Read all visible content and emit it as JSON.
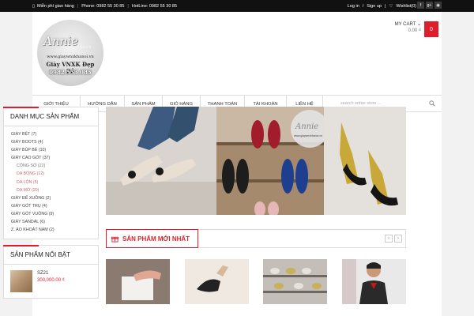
{
  "topbar": {
    "shipping": "Miễn phí giao hàng",
    "phone": "Phone: 0982 55 30 85",
    "hotline": "HotLine: 0982 55 30 85",
    "login": "Log in",
    "signup": "Sign up",
    "wishlist": "Wishlist(0)",
    "social": [
      "f",
      "g+",
      "rss"
    ]
  },
  "logo": {
    "name": "Annie",
    "shop": "SHOP",
    "url": "www.giaywnxkhanoi.vn",
    "tagline": "Giày VNXK Đẹp Rẻ",
    "phone": "0982.553.085"
  },
  "cart": {
    "label": "MY CART",
    "amount": "0.00 ₫",
    "count": "0"
  },
  "nav": {
    "items": [
      "Giới thiệu",
      "Hướng dẫn",
      "Sản phẩm",
      "Giỏ hàng",
      "Thanh toán",
      "Tài khoản",
      "Liên hệ"
    ],
    "search_placeholder": "search entire store ..."
  },
  "categories": {
    "title": "Danh mục sản phẩm",
    "items": [
      "GIÀY BỆT (7)",
      "GIÀY BOOTS (4)",
      "GIÀY BÚP BÊ (10)",
      "GIÀY CAO GÓT (37)",
      "CÔNG SỞ (22)",
      "DA BÓNG (12)",
      "DA LỘN (5)",
      "DA MỜ (20)",
      "GIÀY ĐẾ XUỒNG (2)",
      "GIÀY GÓT TRỤ (4)",
      "GIÀY GÓT VUÔNG (9)",
      "GIÀY SANDAL (6)",
      "Z. ÁO KHOÁT NAM (2)"
    ]
  },
  "featured": {
    "title": "Sản phẩm nổi bật",
    "item_name": "SZ21",
    "item_price": "300,000.00 ₫"
  },
  "new_products": {
    "title": "Sản phẩm mới nhất",
    "prev": "‹",
    "next": "›"
  },
  "banner": {
    "watermark_name": "Annie",
    "watermark_url": "www.giaywnxkhanoi.vn"
  },
  "colors": {
    "accent": "#e01e2b",
    "topbar": "#111111"
  }
}
